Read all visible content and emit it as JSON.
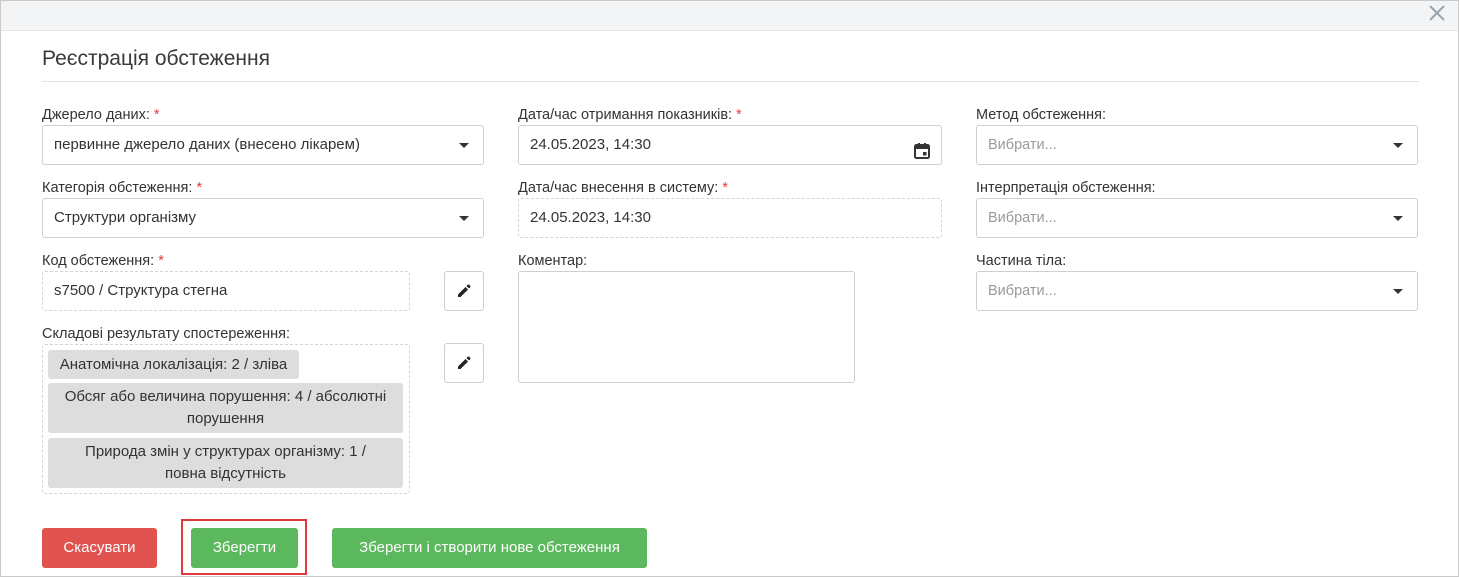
{
  "dialog": {
    "title": "Реєстрація обстеження",
    "close_icon": "close-icon"
  },
  "col1": {
    "source": {
      "label": "Джерело даних:",
      "required": "*",
      "value": "первинне джерело даних (внесено лікарем)"
    },
    "category": {
      "label": "Категорія обстеження:",
      "required": "*",
      "value": "Структури організму"
    },
    "code": {
      "label": "Код обстеження:",
      "required": "*",
      "value": "s7500 / Структура стегна",
      "edit_icon": "pencil-icon"
    },
    "components": {
      "label": "Складові результату спостереження:",
      "items": [
        {
          "line1": "Анатомічна локалізація: 2 / зліва",
          "line2": ""
        },
        {
          "line1": "Обсяг або величина порушення: 4 / абсолютні",
          "line2": "порушення"
        },
        {
          "line1": "Природа змін у структурах організму: 1 /",
          "line2": "повна відсутність"
        }
      ],
      "edit_icon": "pencil-icon"
    }
  },
  "col2": {
    "received": {
      "label": "Дата/час отримання показників:",
      "required": "*",
      "value": "24.05.2023, 14:30",
      "icon": "calendar-icon"
    },
    "entered": {
      "label": "Дата/час внесення в систему:",
      "required": "*",
      "value": "24.05.2023, 14:30"
    },
    "comment": {
      "label": "Коментар:",
      "value": ""
    }
  },
  "col3": {
    "method": {
      "label": "Метод обстеження:",
      "placeholder": "Вибрати..."
    },
    "interpretation": {
      "label": "Інтерпретація обстеження:",
      "placeholder": "Вибрати..."
    },
    "body_part": {
      "label": "Частина тіла:",
      "placeholder": "Вибрати..."
    }
  },
  "footer": {
    "cancel_label": "Скасувати",
    "save_label": "Зберегти",
    "save_new_label": "Зберегти і створити нове обстеження"
  },
  "colors": {
    "danger": "#e0534f",
    "success": "#5cb85c",
    "required": "#e23c3c",
    "focus_ring": "#e0393b"
  }
}
